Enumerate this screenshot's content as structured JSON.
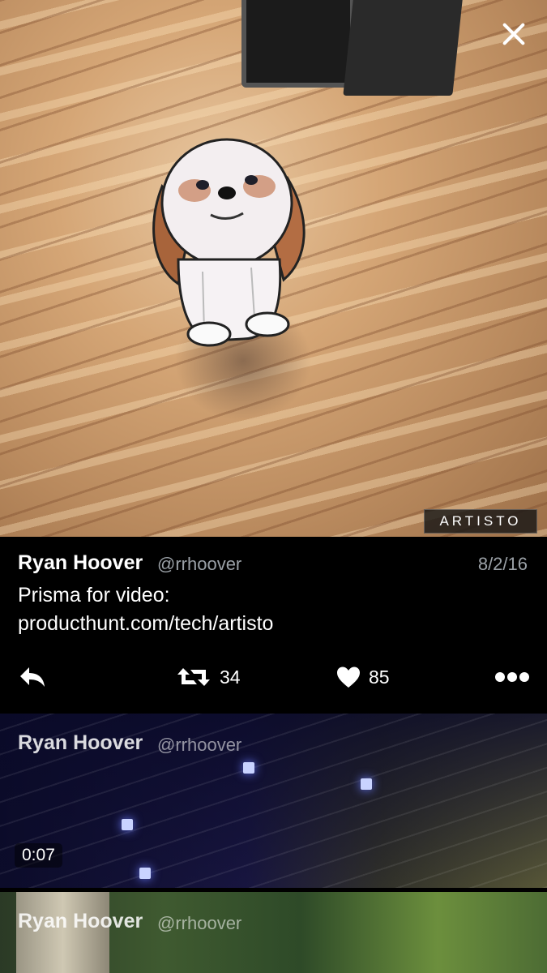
{
  "media": {
    "watermark": "ARTISTO"
  },
  "tweet": {
    "author_name": "Ryan Hoover",
    "author_handle": "@rrhoover",
    "date": "8/2/16",
    "text_line1": "Prisma for video:",
    "text_line2": "producthunt.com/tech/artisto",
    "retweet_count": "34",
    "like_count": "85"
  },
  "feed": [
    {
      "author_name": "Ryan Hoover",
      "author_handle": "@rrhoover",
      "duration": "0:07"
    },
    {
      "author_name": "Ryan Hoover",
      "author_handle": "@rrhoover"
    }
  ],
  "icons": {
    "close": "close-icon",
    "reply": "reply-icon",
    "retweet": "retweet-icon",
    "like": "heart-icon",
    "more": "more-icon"
  }
}
